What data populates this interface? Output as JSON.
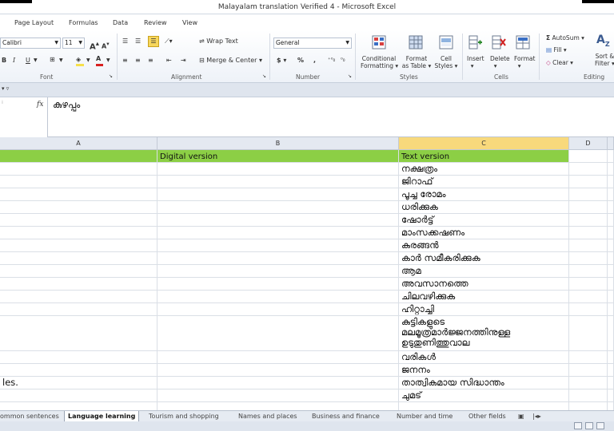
{
  "window": {
    "title": "Malayalam translation Verified 4  -  Microsoft Excel"
  },
  "menu_tabs": [
    "Page Layout",
    "Formulas",
    "Data",
    "Review",
    "View"
  ],
  "ribbon": {
    "font_name": "Calibri",
    "font_size": "11",
    "font_group": "Font",
    "alignment_group": "Alignment",
    "wrap_text": "Wrap Text",
    "merge_center": "Merge & Center",
    "number_format": "General",
    "number_group": "Number",
    "currency_symbol": "$",
    "percent_symbol": "%",
    "comma_symbol": ",",
    "conditional_formatting": [
      "Conditional",
      "Formatting"
    ],
    "format_as_table": [
      "Format",
      "as Table"
    ],
    "cell_styles": [
      "Cell",
      "Styles"
    ],
    "styles_group": "Styles",
    "insert": "Insert",
    "delete": "Delete",
    "format": "Format",
    "cells_group": "Cells",
    "autosum": "AutoSum",
    "fill": "Fill",
    "clear": "Clear",
    "sort_filter": [
      "Sort &",
      "Filter"
    ],
    "editing_group": "Editing",
    "bold": "B",
    "italic": "I",
    "underline": "U",
    "grow_font": "A",
    "shrink_font": "A",
    "highlight_color": "#f7e04a",
    "font_color": "#d82020"
  },
  "formula_bar": {
    "fx_label": "fx",
    "content": "കുഴപ്പം"
  },
  "columns": [
    "A",
    "B",
    "C",
    "D"
  ],
  "selected_column": "C",
  "rows": [
    {
      "a": "",
      "b": "Digital version",
      "c": "Text version",
      "header": true
    },
    {
      "a": "",
      "b": "",
      "c": "നക്ഷത്രം"
    },
    {
      "a": "",
      "b": "",
      "c": "ജിറാഫ്"
    },
    {
      "a": "",
      "b": "",
      "c": "പൂച്ച രോമം"
    },
    {
      "a": "",
      "b": "",
      "c": "ധരിക്കുക"
    },
    {
      "a": "",
      "b": "",
      "c": "ഷോർട്ട്"
    },
    {
      "a": "",
      "b": "",
      "c": "മാംസക്കഷണം"
    },
    {
      "a": "",
      "b": "",
      "c": "കുരങ്ങൻ"
    },
    {
      "a": "",
      "b": "",
      "c": "കാർ സമീകരിക്കുക"
    },
    {
      "a": "",
      "b": "",
      "c": "ആമ"
    },
    {
      "a": "",
      "b": "",
      "c": "അവസാനത്തെ"
    },
    {
      "a": "",
      "b": "",
      "c": "ചിലവഴിക്കുക"
    },
    {
      "a": "",
      "b": "",
      "c": "ഹിറ്റാച്ചി"
    },
    {
      "a": "",
      "b": "",
      "c": "കുട്ടികളുടെ\nമലമൂത്രമാർജ്ജനത്തിനുള്ള\nഉടുതുണിത്തുവാല",
      "tall": true
    },
    {
      "a": "",
      "b": "",
      "c": "വരികൾ"
    },
    {
      "a": "",
      "b": "",
      "c": "ജനനം"
    },
    {
      "a": "les.",
      "b": "",
      "c": "താത്വികമായ സിദ്ധാന്തം"
    },
    {
      "a": "",
      "b": "",
      "c": "ചുമട്"
    },
    {
      "a": "",
      "b": "",
      "c": ""
    }
  ],
  "sheet_tabs": [
    "ommon sentences",
    "Language learning",
    "Tourism and shopping",
    "Names and places",
    "Business and finance",
    "Number and time",
    "Other fields"
  ],
  "active_sheet": "Language learning",
  "colors": {
    "header_green": "#8ccf45",
    "selected_header": "#f8d97c",
    "ribbon_bg": "#eef2f8"
  }
}
